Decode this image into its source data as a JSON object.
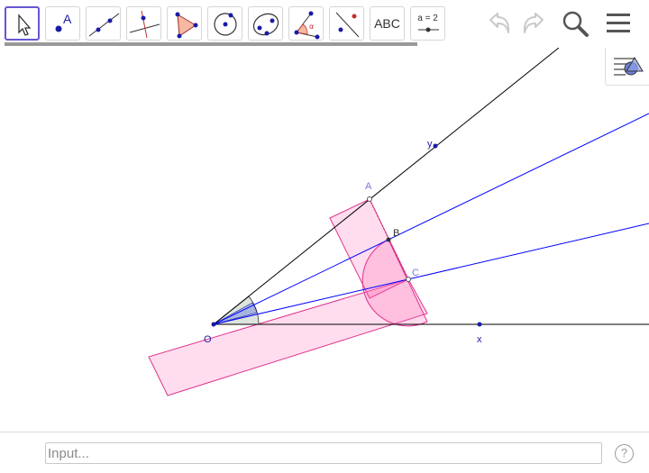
{
  "toolbar": {
    "tools": [
      {
        "name": "move"
      },
      {
        "name": "point",
        "label": "A"
      },
      {
        "name": "line"
      },
      {
        "name": "perpendicular-line"
      },
      {
        "name": "polygon"
      },
      {
        "name": "circle-center-point"
      },
      {
        "name": "conic-through-points"
      },
      {
        "name": "angle",
        "label": "α"
      },
      {
        "name": "reflect-about-line"
      },
      {
        "name": "text",
        "label": "ABC"
      },
      {
        "name": "slider",
        "label": "a = 2"
      }
    ]
  },
  "canvas": {
    "points": [
      {
        "id": "O",
        "label": "O"
      },
      {
        "id": "x",
        "label": "x"
      },
      {
        "id": "y",
        "label": "y"
      },
      {
        "id": "A",
        "label": "A"
      },
      {
        "id": "B",
        "label": "B"
      },
      {
        "id": "C",
        "label": "C"
      }
    ]
  },
  "input": {
    "placeholder": "Input..."
  },
  "help": {
    "label": "?"
  },
  "colors": {
    "accent": "#6557d2",
    "ray": "#0000ff",
    "fill": "#ff66b3",
    "axis": "#000000"
  }
}
